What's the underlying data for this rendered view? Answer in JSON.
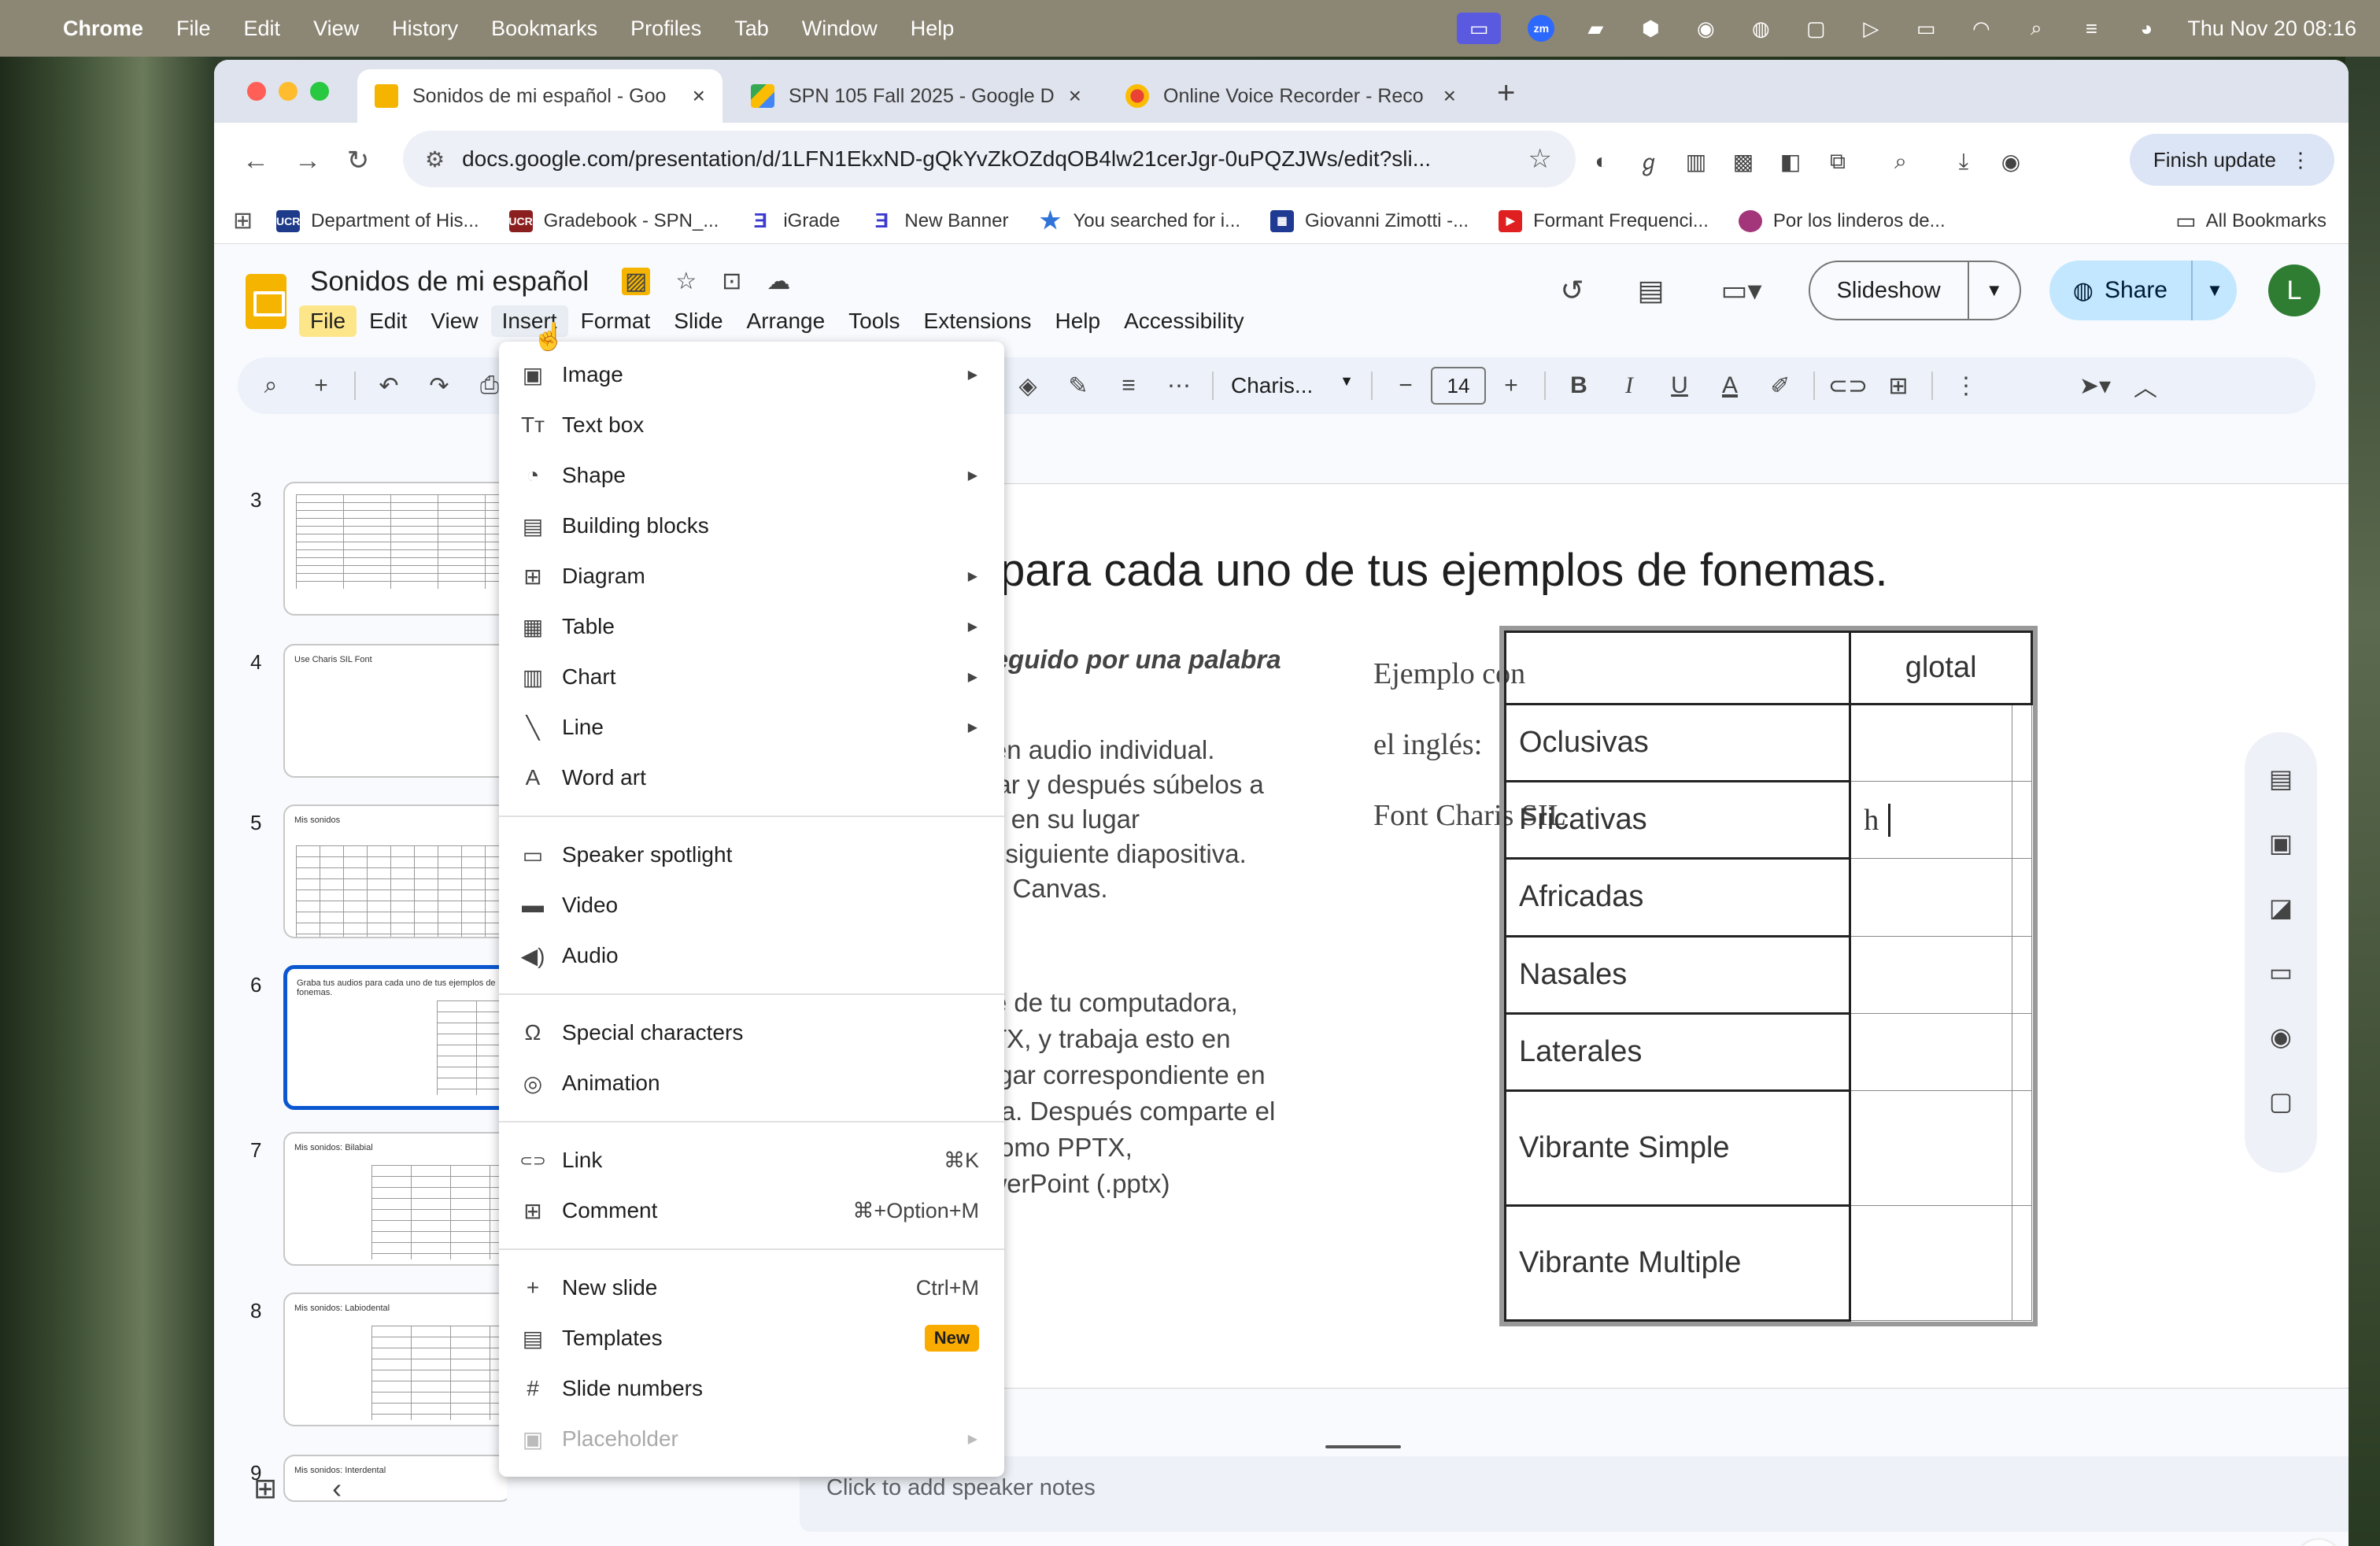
{
  "menubar": {
    "app": "Chrome",
    "items": [
      "File",
      "Edit",
      "View",
      "History",
      "Bookmarks",
      "Profiles",
      "Tab",
      "Window",
      "Help"
    ],
    "clock": "Thu Nov 20  08:16"
  },
  "tabs": [
    {
      "title": "Sonidos de mi español - Goo",
      "color": "#f4b400"
    },
    {
      "title": "SPN 105 Fall 2025 - Google D",
      "color": "#34a853"
    },
    {
      "title": "Online Voice Recorder - Reco",
      "color": "#ea4335"
    }
  ],
  "browser": {
    "url": "docs.google.com/presentation/d/1LFN1EkxND-gQkYvZkOZdqOB4lw21cerJgr-0uPQZJWs/edit?sli...",
    "finish_update": "Finish update"
  },
  "bookmarks": [
    {
      "label": "Department of His...",
      "color": "#1e3a8a",
      "icon": "UCR"
    },
    {
      "label": "Gradebook - SPN_...",
      "color": "#8b1e1e",
      "icon": "UCR"
    },
    {
      "label": "iGrade",
      "color": "#3b3bd0",
      "icon": "3"
    },
    {
      "label": "New Banner",
      "color": "#3b3bd0",
      "icon": "3"
    },
    {
      "label": "You searched for i...",
      "color": "#2f73d9",
      "icon": "★"
    },
    {
      "label": "Giovanni Zimotti -...",
      "color": "#1f3a93",
      "icon": "▦"
    },
    {
      "label": "Formant Frequenci...",
      "color": "#e02020",
      "icon": "▶"
    },
    {
      "label": "Por los linderos de...",
      "color": "#a3357a",
      "icon": "●"
    }
  ],
  "all_bookmarks": "All Bookmarks",
  "doc": {
    "title": "Sonidos de mi español",
    "menus": [
      "File",
      "Edit",
      "View",
      "Insert",
      "Format",
      "Slide",
      "Arrange",
      "Tools",
      "Extensions",
      "Help",
      "Accessibility"
    ],
    "slideshow": "Slideshow",
    "share": "Share",
    "avatar": "L",
    "font": "Charis...",
    "font_size": "14"
  },
  "thumbnails": [
    {
      "num": "3",
      "title": ""
    },
    {
      "num": "4",
      "title": "Use Charis SIL Font"
    },
    {
      "num": "5",
      "title": "Mis sonidos"
    },
    {
      "num": "6",
      "title": "Graba tus audios para cada uno de tus ejemplos de fonemas."
    },
    {
      "num": "7",
      "title": "Mis sonidos: Bilabial"
    },
    {
      "num": "8",
      "title": "Mis sonidos: Labiodental"
    },
    {
      "num": "9",
      "title": "Mis sonidos: Interdental"
    }
  ],
  "slide": {
    "title": "s para cada uno de tus ejemplos de fonemas.",
    "subtitle": "n seguido por una palabra",
    "body1": [
      "na en audio individual.",
      "elular y después súbelos a",
      "idos en su lugar",
      "n la siguiente diapositiva.",
      "s en Canvas."
    ],
    "body2": [
      "ente de tu computadora,",
      "PPTX, y trabaja esto en",
      "u lugar correspondiente en",
      "sitiva. Después comparte el",
      "ar como PPTX,",
      "PowerPoint (.pptx)"
    ],
    "example": [
      "Ejemplo con",
      "el inglés:",
      "Font Charis SIL"
    ],
    "table_header": "glotal",
    "rows": [
      "Oclusivas",
      "Fricativas",
      "Africadas",
      "Nasales",
      "Laterales",
      "Vibrante Simple",
      "Vibrante Multiple"
    ],
    "cell_text": "h"
  },
  "notes": "Click to add speaker notes",
  "insert_menu": {
    "items": [
      {
        "label": "Image",
        "icon": "▣",
        "arrow": true
      },
      {
        "label": "Text box",
        "icon": "Tт"
      },
      {
        "label": "Shape",
        "icon": "◔",
        "arrow": true
      },
      {
        "label": "Building blocks",
        "icon": "▤"
      },
      {
        "label": "Diagram",
        "icon": "⊞",
        "arrow": true
      },
      {
        "label": "Table",
        "icon": "▦",
        "arrow": true
      },
      {
        "label": "Chart",
        "icon": "▥",
        "arrow": true
      },
      {
        "label": "Line",
        "icon": "╲",
        "arrow": true
      },
      {
        "label": "Word art",
        "icon": "A"
      },
      {
        "divider": true
      },
      {
        "label": "Speaker spotlight",
        "icon": "▭"
      },
      {
        "label": "Video",
        "icon": "▬"
      },
      {
        "label": "Audio",
        "icon": "◀)"
      },
      {
        "divider": true
      },
      {
        "label": "Special characters",
        "icon": "Ω"
      },
      {
        "label": "Animation",
        "icon": "◎"
      },
      {
        "divider": true
      },
      {
        "label": "Link",
        "icon": "⊂⊃",
        "shortcut": "⌘K"
      },
      {
        "label": "Comment",
        "icon": "⊞",
        "shortcut": "⌘+Option+M"
      },
      {
        "divider": true
      },
      {
        "label": "New slide",
        "icon": "+",
        "shortcut": "Ctrl+M"
      },
      {
        "label": "Templates",
        "icon": "▤",
        "badge": "New"
      },
      {
        "label": "Slide numbers",
        "icon": "#"
      },
      {
        "label": "Placeholder",
        "icon": "▣",
        "arrow": true,
        "disabled": true
      }
    ]
  }
}
